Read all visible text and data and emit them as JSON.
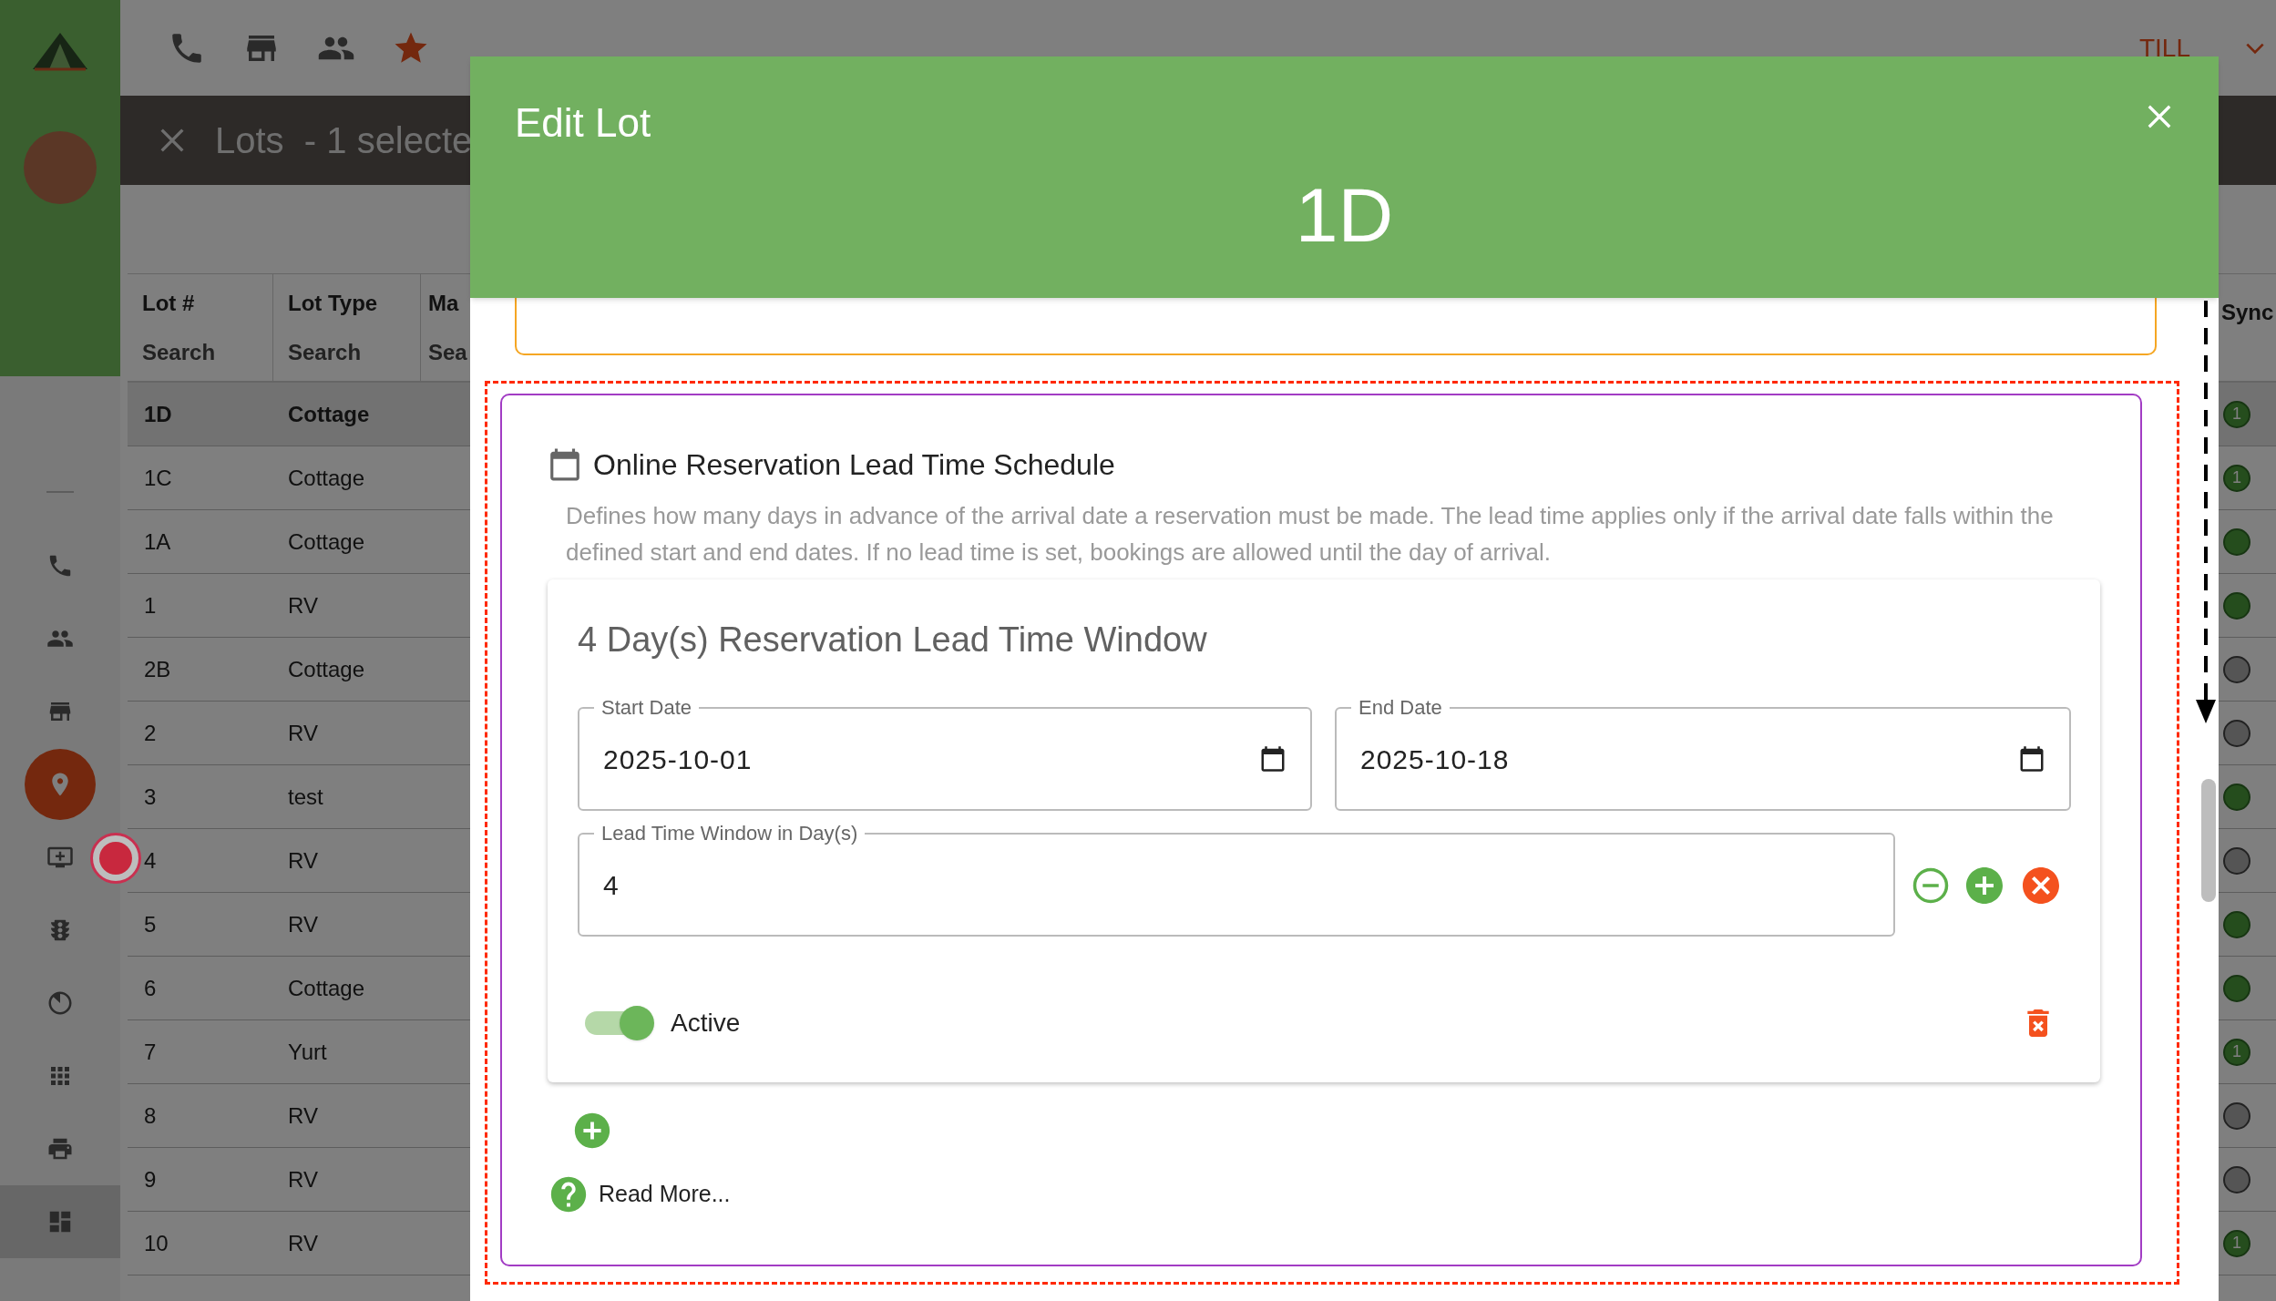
{
  "top_bar": {
    "user": "TILL"
  },
  "sidebar": {
    "items": [
      {
        "kind": "phone",
        "selected": false,
        "hovered": false
      },
      {
        "kind": "people",
        "selected": false,
        "hovered": false
      },
      {
        "kind": "store",
        "selected": false,
        "hovered": false
      },
      {
        "kind": "pin",
        "selected": true,
        "hovered": false
      },
      {
        "kind": "screen",
        "selected": false,
        "hovered": false
      },
      {
        "kind": "traffic",
        "selected": false,
        "hovered": false
      },
      {
        "kind": "timer",
        "selected": false,
        "hovered": false
      },
      {
        "kind": "grid",
        "selected": false,
        "hovered": false
      },
      {
        "kind": "print",
        "selected": false,
        "hovered": false
      },
      {
        "kind": "dashboard",
        "selected": false,
        "hovered": true
      }
    ]
  },
  "page_header": {
    "title": "Lots  - 1 selecte"
  },
  "table": {
    "columns": [
      {
        "label": "Lot #",
        "filter": "Search"
      },
      {
        "label": "Lot Type",
        "filter": "Search"
      },
      {
        "label": "Ma",
        "filter": "Sea"
      }
    ],
    "sync_column": "Sync",
    "rows": [
      {
        "lot": "1D",
        "type": "Cottage",
        "selected": true,
        "synced": true,
        "count": "1"
      },
      {
        "lot": "1C",
        "type": "Cottage",
        "selected": false,
        "synced": true,
        "count": "1"
      },
      {
        "lot": "1A",
        "type": "Cottage",
        "selected": false,
        "synced": true
      },
      {
        "lot": "1",
        "type": "RV",
        "selected": false,
        "synced": true
      },
      {
        "lot": "2B",
        "type": "Cottage",
        "selected": false,
        "synced": false
      },
      {
        "lot": "2",
        "type": "RV",
        "selected": false,
        "synced": false
      },
      {
        "lot": "3",
        "type": "test",
        "selected": false,
        "synced": true
      },
      {
        "lot": "4",
        "type": "RV",
        "selected": false,
        "synced": false
      },
      {
        "lot": "5",
        "type": "RV",
        "selected": false,
        "synced": true
      },
      {
        "lot": "6",
        "type": "Cottage",
        "selected": false,
        "synced": true
      },
      {
        "lot": "7",
        "type": "Yurt",
        "selected": false,
        "synced": true,
        "count": "1"
      },
      {
        "lot": "8",
        "type": "RV",
        "selected": false,
        "synced": false
      },
      {
        "lot": "9",
        "type": "RV",
        "selected": false,
        "synced": false
      },
      {
        "lot": "10",
        "type": "RV",
        "selected": false,
        "synced": true,
        "count": "1"
      }
    ]
  },
  "modal": {
    "title": "Edit Lot",
    "lot": "1D",
    "section": {
      "title": "Online Reservation Lead Time Schedule",
      "description": "Defines how many days in advance of the arrival date a reservation must be made. The lead time applies only if the arrival date falls within the defined start and end dates. If no lead time is set, bookings are allowed until the day of arrival.",
      "windows": [
        {
          "heading": "4 Day(s) Reservation Lead Time Window",
          "start_date": {
            "label": "Start Date",
            "value": "2025-10-01"
          },
          "end_date": {
            "label": "End Date",
            "value": "2025-10-18"
          },
          "lead_time": {
            "label": "Lead Time Window in Day(s)",
            "value": "4"
          },
          "active": true,
          "active_label": "Active"
        }
      ],
      "read_more": "Read More..."
    }
  }
}
